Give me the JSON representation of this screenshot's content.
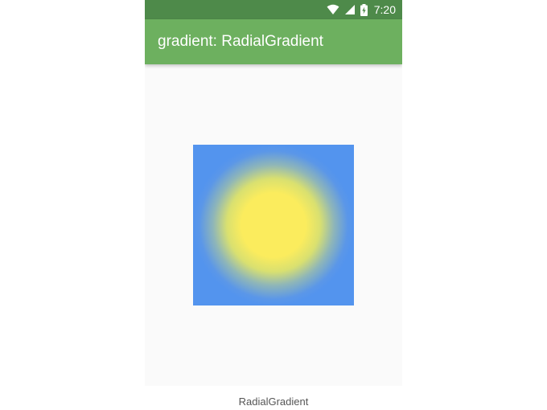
{
  "status_bar": {
    "time": "7:20",
    "icons": [
      "wifi-icon",
      "cell-signal-icon",
      "battery-charging-icon"
    ]
  },
  "app_bar": {
    "title": "gradient: RadialGradient"
  },
  "gradient_box": {
    "center_color": "#fbec5d",
    "edge_color": "#5394ee"
  },
  "caption": "RadialGradient",
  "colors": {
    "status_bar": "#4e8a4a",
    "app_bar": "#6db05f",
    "body_background": "#fafafa"
  }
}
